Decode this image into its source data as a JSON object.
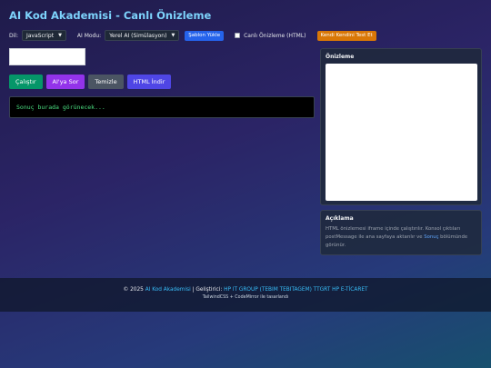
{
  "header": {
    "title": "AI Kod Akademisi - Canlı Önizleme"
  },
  "toolbar": {
    "language_label": "Dil:",
    "language_value": "JavaScript",
    "ai_mode_label": "AI Modu:",
    "ai_mode_value": "Yerel AI (Simülasyon)",
    "template_button": "Şablon Yükle",
    "live_preview_label": "Canlı Önizleme (HTML)",
    "self_test_button": "Kendi Kendini Test Et"
  },
  "actions": {
    "run": "Çalıştır",
    "ask_ai": "AI'ya Sor",
    "clear": "Temizle",
    "download_html": "HTML İndir"
  },
  "output": {
    "placeholder": "Sonuç burada görünecek..."
  },
  "preview": {
    "title": "Önizleme"
  },
  "description": {
    "title": "Açıklama",
    "text_part1": "HTML önizlemesi iframe içinde çalıştırılır. Konsol çıktıları postMessage ile ana sayfaya aktarılır ve ",
    "text_highlight": "Sonuç",
    "text_part2": " bölümünde görünür."
  },
  "footer": {
    "copyright": "© 2025 ",
    "brand": "AI Kod Akademisi",
    "developer_label": " | Geliştirici: ",
    "developer": "HP IT GROUP (TEBIM TEBITAGEM) TTGRT HP E-TİCARET",
    "subline": "TailwindCSS + CodeMirror ile tasarlandı"
  },
  "colors": {
    "accent_title": "#7dd3fc",
    "template_button": "#2563eb",
    "self_test_button": "#d97706",
    "run_button": "#059669",
    "ask_ai_button": "#9333ea",
    "clear_button": "#4b5563",
    "download_button": "#4f46e5",
    "output_text": "#4ade80"
  }
}
